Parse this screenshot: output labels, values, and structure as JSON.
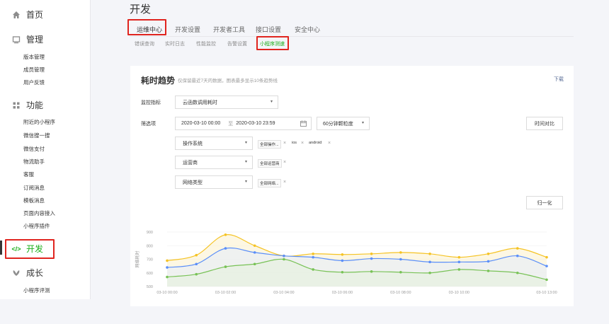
{
  "sidebar": {
    "home": "首页",
    "manage": {
      "title": "管理",
      "items": [
        "版本管理",
        "成员管理",
        "用户反馈"
      ]
    },
    "features": {
      "title": "功能",
      "items": [
        "附近的小程序",
        "微信搜一搜",
        "微信支付",
        "物流助手",
        "客服",
        "订阅消息",
        "模板消息",
        "页面内容接入",
        "小程序插件"
      ]
    },
    "develop": {
      "icon_text": "</>",
      "title": "开发"
    },
    "growth": {
      "title": "成长",
      "items": [
        "小程序评测"
      ]
    }
  },
  "page_title": "开发",
  "tabs": [
    "运维中心",
    "开发设置",
    "开发者工具",
    "接口设置",
    "安全中心"
  ],
  "subtabs": [
    "错误查询",
    "实时日志",
    "性能监控",
    "告警设置",
    "小程序测速"
  ],
  "card": {
    "title": "耗时趋势",
    "subtitle": "仅保留最近7天的数据，图表最多显示10条趋势线",
    "download": "下载",
    "metric_label": "监控指标",
    "metric_value": "云函数调用耗时",
    "filter_label": "筛选项",
    "date_start": "2020-03-10 00:00",
    "date_sep": "至",
    "date_end": "2020-03-10 23:59",
    "granularity": "60分钟颗粒度",
    "compare_button": "时间对比",
    "filters": [
      {
        "name": "操作系统",
        "tags": [
          "全部操作...",
          "ios",
          "android"
        ]
      },
      {
        "name": "运营商",
        "tags": [
          "全部运营商"
        ]
      },
      {
        "name": "网络类型",
        "tags": [
          "全部网络..."
        ]
      }
    ],
    "normalize_button": "归一化"
  },
  "chart_data": {
    "type": "area",
    "ylabel": "网络耗时",
    "ylim": [
      500,
      900
    ],
    "yticks": [
      500,
      600,
      700,
      800,
      900
    ],
    "x": [
      "03-10 00:00",
      "03-10 01:00",
      "03-10 02:00",
      "03-10 03:00",
      "03-10 04:00",
      "03-10 05:00",
      "03-10 06:00",
      "03-10 07:00",
      "03-10 08:00",
      "03-10 09:00",
      "03-10 10:00",
      "03-10 11:00",
      "03-10 12:00",
      "03-10 13:00"
    ],
    "xtick_labels": [
      "03-10 00:00",
      "03-10 02:00",
      "03-10 04:00",
      "03-10 06:00",
      "03-10 08:00",
      "03-10 10:00",
      "03-10 13:00"
    ],
    "series": [
      {
        "color": "#f5c324",
        "fill": "#fbf1cc",
        "values": [
          690,
          730,
          880,
          800,
          725,
          740,
          735,
          740,
          750,
          740,
          715,
          740,
          780,
          715
        ]
      },
      {
        "color": "#5b8ff9",
        "fill": "#e3ecfb",
        "values": [
          640,
          665,
          780,
          750,
          725,
          715,
          690,
          705,
          700,
          680,
          680,
          685,
          725,
          650
        ]
      },
      {
        "color": "#78c256",
        "fill": "#e4f1dc",
        "values": [
          570,
          590,
          645,
          665,
          700,
          625,
          605,
          610,
          605,
          600,
          625,
          615,
          600,
          550
        ]
      }
    ]
  }
}
